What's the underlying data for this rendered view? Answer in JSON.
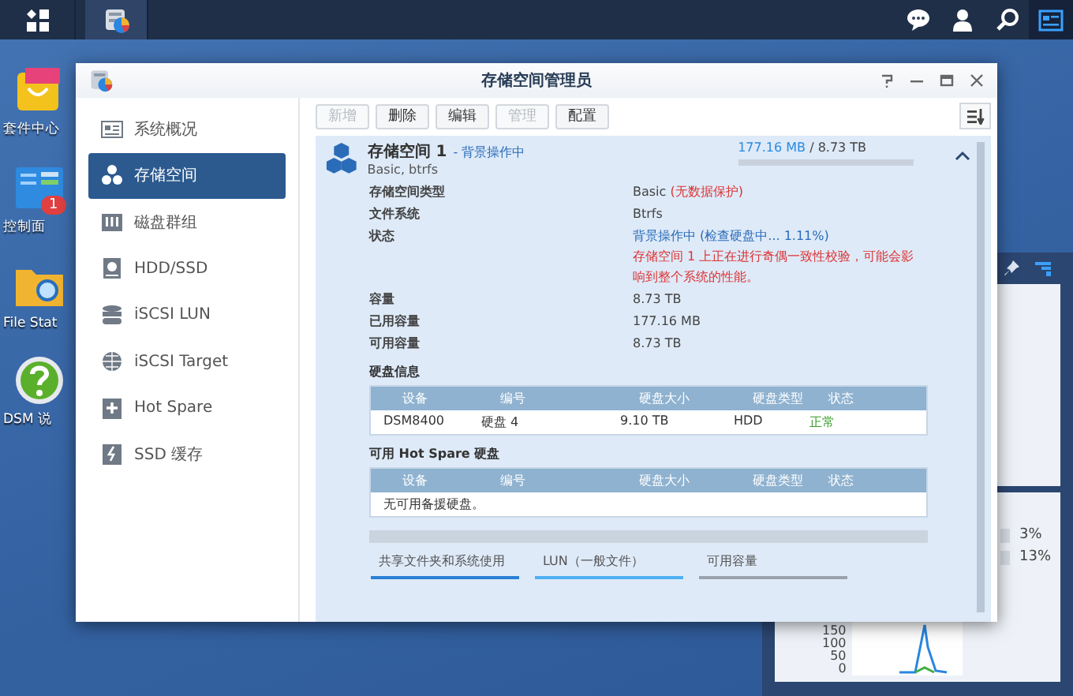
{
  "desktop_icons": [
    {
      "kind": "package",
      "label": "套件中心"
    },
    {
      "kind": "control",
      "label": "控制面",
      "badge": "1"
    },
    {
      "kind": "folder",
      "label": "File Stat"
    },
    {
      "kind": "help",
      "label": "DSM 说"
    }
  ],
  "window": {
    "title": "存储空间管理员",
    "sidebar": [
      {
        "kind": "overview",
        "label": "系统概况",
        "selected": false
      },
      {
        "kind": "volume",
        "label": "存储空间",
        "selected": true
      },
      {
        "kind": "raid",
        "label": "磁盘群组",
        "selected": false
      },
      {
        "kind": "hdd",
        "label": "HDD/SSD",
        "selected": false
      },
      {
        "kind": "lun",
        "label": "iSCSI LUN",
        "selected": false
      },
      {
        "kind": "target",
        "label": "iSCSI Target",
        "selected": false
      },
      {
        "kind": "spare",
        "label": "Hot Spare",
        "selected": false
      },
      {
        "kind": "cache",
        "label": "SSD 缓存",
        "selected": false
      }
    ],
    "toolbar": [
      {
        "label": "新增",
        "disabled": true
      },
      {
        "label": "删除",
        "disabled": false
      },
      {
        "label": "编辑",
        "disabled": false
      },
      {
        "label": "管理",
        "disabled": true
      },
      {
        "label": "配置",
        "disabled": false
      }
    ],
    "volume": {
      "name": "存储空间 1",
      "activity": "- 背景操作中",
      "subtitle": "Basic, btrfs",
      "used": "177.16 MB",
      "total": " / 8.73 TB",
      "level": 0,
      "expanded": true,
      "properties": [
        {
          "label": "存储空间类型",
          "value": "Basic",
          "note": "(无数据保护)",
          "busy": false
        },
        {
          "label": "文件系统",
          "value": "Btrfs",
          "busy": false
        },
        {
          "label": "状态",
          "value": "背景操作中 (检查硬盘中... 1.11%)",
          "busy": true,
          "warning": "存储空间 1 上正在进行奇偶一致性校验，可能会影响到整个系统的性能。"
        },
        {
          "label": "容量",
          "value": "8.73 TB",
          "busy": false
        },
        {
          "label": "已用容量",
          "value": "177.16 MB",
          "busy": false
        },
        {
          "label": "可用容量",
          "value": "8.73 TB",
          "busy": false
        }
      ],
      "disk_info": {
        "title": "硬盘信息",
        "columns": [
          "设备",
          "编号",
          "硬盘大小",
          "硬盘类型",
          "状态"
        ],
        "rows": [
          {
            "cells": [
              "DSM8400",
              "硬盘 4",
              "9.10 TB",
              "HDD",
              "正常"
            ],
            "healthy": true
          }
        ]
      },
      "hot_spare": {
        "title": "可用 Hot Spare 硬盘",
        "columns": [
          "设备",
          "编号",
          "硬盘大小",
          "硬盘类型",
          "状态"
        ],
        "empty": "无可用备援硬盘。"
      },
      "legend": [
        {
          "label": "共享文件夹和系统使用",
          "color": "#2b7fd6"
        },
        {
          "label": "LUN（一般文件）",
          "color": "#4fb0f2"
        },
        {
          "label": "可用容量",
          "color": "#9aa3ad"
        }
      ]
    }
  },
  "widget": {
    "readings": [
      "3%",
      "13%"
    ],
    "axis_labels": [
      "150",
      "100",
      "50",
      "0"
    ]
  }
}
